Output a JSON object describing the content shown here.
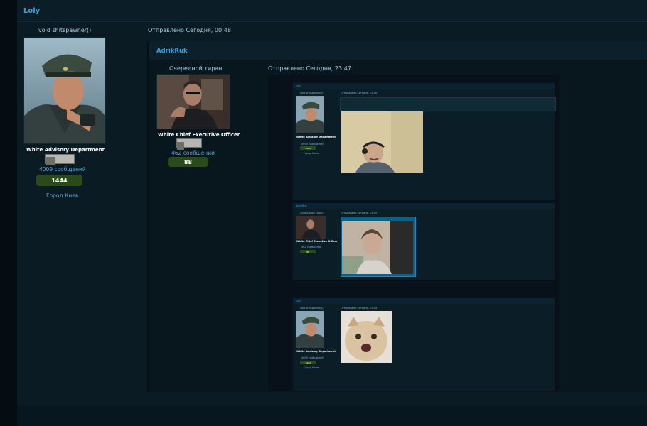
{
  "thread": {
    "author": "Loly"
  },
  "post": {
    "user_title": "void shitspawner()",
    "rank": "White Advisory Department",
    "messages": "4009 сообщений",
    "reputation": "1444",
    "city": "Город Киев",
    "date": "Отправлено Сегодня, 00:48"
  },
  "quote": {
    "author": "AdrikRuk",
    "user_title": "Очередной тиран",
    "rank": "White Chief Executive Officer",
    "messages": "462 сообщений",
    "reputation": "88",
    "date": "Отправлено Сегодня, 23:47"
  },
  "nested": [
    {
      "author": "Loly",
      "user_title": "void shitspawner()",
      "rank": "White Advisory Department",
      "messages": "4009 сообщений",
      "reputation": "1444",
      "city": "Город Киев",
      "date": "Отправлено Сегодня, 23:46"
    },
    {
      "author": "AdrikRuk",
      "user_title": "Очередной тиран",
      "rank": "White Chief Executive Officer",
      "messages": "462 сообщений",
      "reputation": "88",
      "date": "Отправлено Сегодня, 23:45"
    },
    {
      "author": "Loly",
      "user_title": "void shitspawner()",
      "rank": "White Advisory Department",
      "messages": "4009 сообщений",
      "reputation": "1444",
      "city": "Город Киев",
      "date": "Отправлено Сегодня, 23:44"
    }
  ],
  "colors": {
    "accent": "#2fa3dd",
    "rep_button": "#2b4a1a",
    "background": "#0a1b24"
  }
}
